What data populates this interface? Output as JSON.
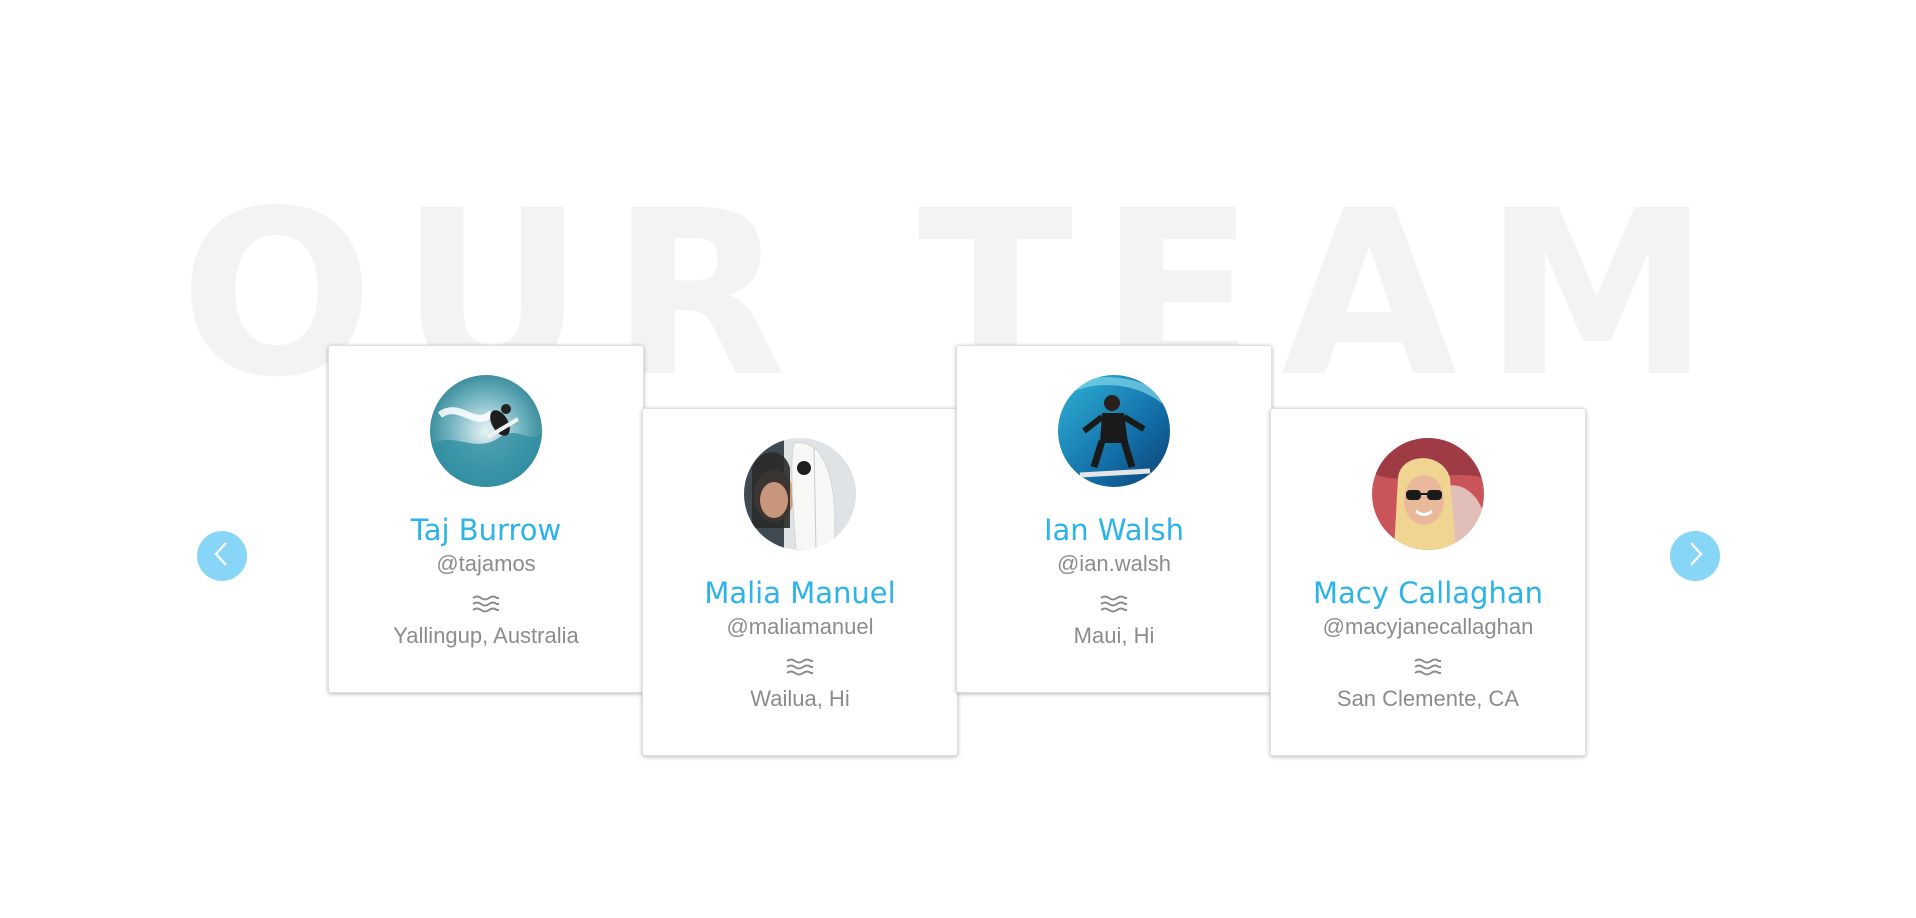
{
  "section": {
    "background_title": "OUR TEAM"
  },
  "carousel": {
    "prev_icon": "chevron-left-icon",
    "next_icon": "chevron-right-icon",
    "arrow_color": "#87d6f7"
  },
  "accent_color": "#2bb3ea",
  "location_icon": "waves-icon",
  "members": [
    {
      "name": "Taj Burrow",
      "handle": "@tajamos",
      "location": "Yallingup, Australia"
    },
    {
      "name": "Malia Manuel",
      "handle": "@maliamanuel",
      "location": "Wailua, Hi"
    },
    {
      "name": "Ian Walsh",
      "handle": "@ian.walsh",
      "location": "Maui, Hi"
    },
    {
      "name": "Macy Callaghan",
      "handle": "@macyjanecallaghan",
      "location": "San Clemente, CA"
    }
  ]
}
